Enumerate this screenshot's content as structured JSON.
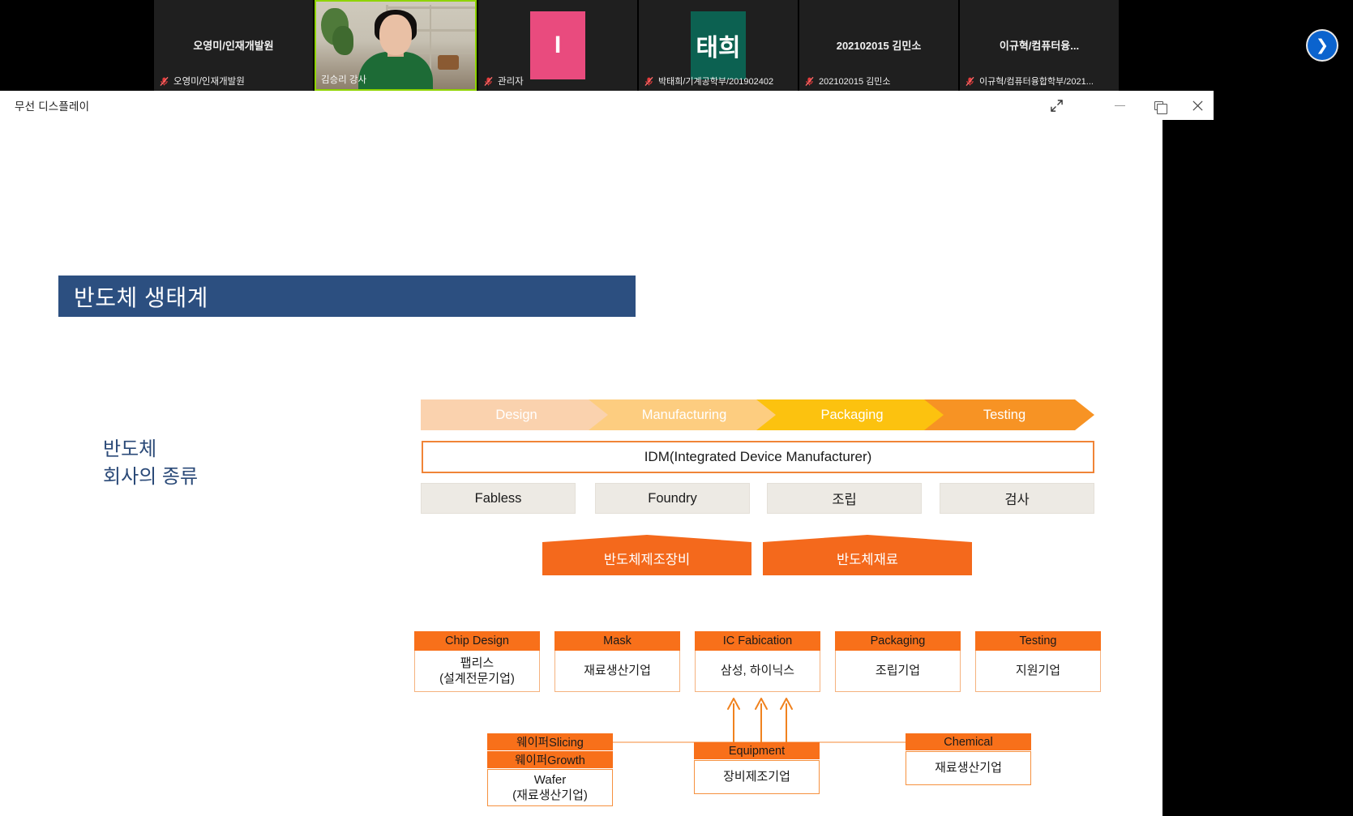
{
  "filmstrip": {
    "participants": [
      {
        "display_name": "오영미/인재개발원",
        "footer_label": "오영미/인재개발원",
        "muted": true,
        "kind": "name-only"
      },
      {
        "display_name": "",
        "footer_label": "김승리 강사",
        "muted": false,
        "kind": "video"
      },
      {
        "display_name": "I",
        "footer_label": "관리자",
        "muted": true,
        "kind": "avatar-pink"
      },
      {
        "display_name": "태희",
        "footer_label": "박태희/기계공학부/201902402",
        "muted": true,
        "kind": "avatar-teal"
      },
      {
        "display_name": "202102015 김민소",
        "footer_label": "202102015 김민소",
        "muted": true,
        "kind": "name-only"
      },
      {
        "display_name": "이규혁/컴퓨터융...",
        "footer_label": "이규혁/컴퓨터융합학부/2021...",
        "muted": true,
        "kind": "name-only"
      }
    ],
    "next_button_glyph": "❯",
    "mic_off_icon": "mic-off-icon"
  },
  "window": {
    "title": "무선 디스플레이",
    "expand_glyph": "⤢",
    "minimize_label": "minimize",
    "maximize_label": "maximize",
    "close_glyph": "✕"
  },
  "slide": {
    "title": "반도체 생태계",
    "side_heading": "반도체\n회사의 종류",
    "process_steps": [
      {
        "label": "Design",
        "color": "#fad2ae"
      },
      {
        "label": "Manufacturing",
        "color": "#fdcd80"
      },
      {
        "label": "Packaging",
        "color": "#fcc20f"
      },
      {
        "label": "Testing",
        "color": "#f79324"
      }
    ],
    "idm_bar": "IDM(Integrated Device Manufacturer)",
    "role_boxes": [
      "Fabless",
      "Foundry",
      "조립",
      "검사"
    ],
    "supply_pentagons": [
      "반도체제조장비",
      "반도체재료"
    ],
    "value_chain": [
      {
        "header": "Chip Design",
        "body": "팹리스\n(설계전문기업)"
      },
      {
        "header": "Mask",
        "body": "재료생산기업"
      },
      {
        "header": "IC Fabication",
        "body": "삼성, 하이닉스"
      },
      {
        "header": "Packaging",
        "body": "조립기업"
      },
      {
        "header": "Testing",
        "body": "지원기업"
      }
    ],
    "suppliers": {
      "wafer": {
        "headers": [
          "웨이퍼Slicing",
          "웨이퍼Growth"
        ],
        "body": "Wafer\n(재료생산기업)"
      },
      "equipment": {
        "headers": [
          "Equipment"
        ],
        "body": "장비제조기업"
      },
      "chemical": {
        "headers": [
          "Chemical"
        ],
        "body": "재료생산기업"
      }
    }
  },
  "colors": {
    "title_bar": "#2c4f80",
    "accent_orange": "#f4691c",
    "header_orange": "#f8701a",
    "idm_border": "#f08437",
    "grey_box": "#edeae4",
    "heading_blue": "#2b4a78"
  }
}
